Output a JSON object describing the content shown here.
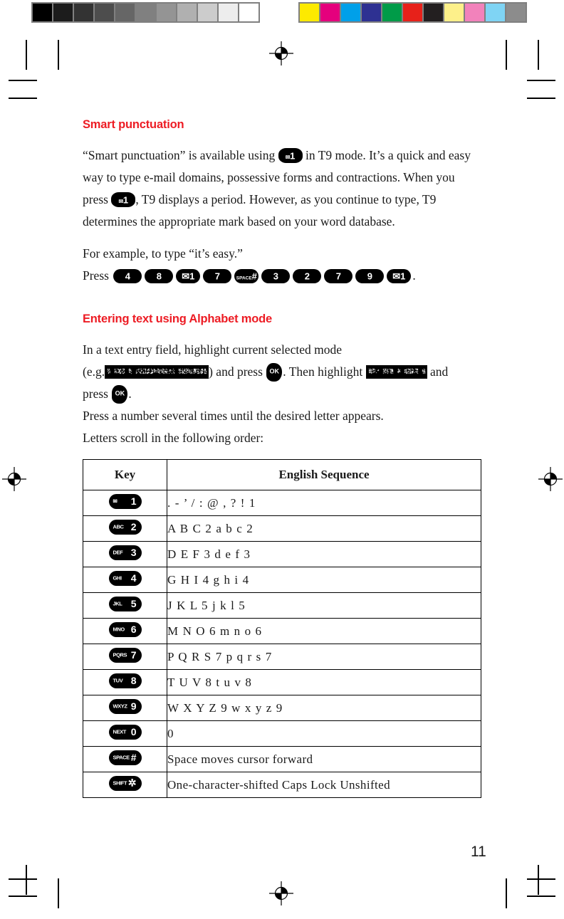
{
  "page": {
    "number": "11"
  },
  "calibration": {
    "grayscale_label": "grayscale-step-wedge",
    "grayscale": [
      "#000000",
      "#1c1c1c",
      "#333333",
      "#4d4d4d",
      "#666666",
      "#808080",
      "#949494",
      "#b0b0b0",
      "#cccccc",
      "#ededed",
      "#ffffff"
    ],
    "color_label": "color-control-bar",
    "colors": [
      "#fdea00",
      "#e5007d",
      "#00a0e9",
      "#2e3192",
      "#009b48",
      "#e7211a",
      "#231f20",
      "#fdf08a",
      "#f282bb",
      "#7fd4f4",
      "#8c8c8c"
    ]
  },
  "accent_color": "#ED1C24",
  "sections": [
    {
      "heading": "Smart punctuation",
      "paragraphs": [
        {
          "parts": [
            {
              "t": "text",
              "v": "“Smart punctuation” is available using "
            },
            {
              "t": "key",
              "v": "1",
              "sub": "✉"
            },
            {
              "t": "text",
              "v": " in T9 mode. It’s a quick and easy way to type e-mail domains, possessive forms and contractions. When you press "
            },
            {
              "t": "key",
              "v": "1",
              "sub": "✉"
            },
            {
              "t": "text",
              "v": ", T9 displays a period. However, as you continue to type, T9 determines the appropriate mark based on your word database."
            }
          ]
        }
      ],
      "example_line": "For example, to type “it’s easy.”",
      "press_label": "Press",
      "press_sequence": [
        {
          "num": "4",
          "sub": ""
        },
        {
          "num": "8",
          "sub": ""
        },
        {
          "num": "1",
          "sub": "✉"
        },
        {
          "num": "7",
          "sub": ""
        },
        {
          "num": "#",
          "sub": "SPACE"
        },
        {
          "num": "3",
          "sub": ""
        },
        {
          "num": "2",
          "sub": ""
        },
        {
          "num": "7",
          "sub": ""
        },
        {
          "num": "9",
          "sub": ""
        },
        {
          "num": "1",
          "sub": "✉"
        }
      ],
      "press_period": "."
    },
    {
      "heading": "Entering text using Alphabet mode",
      "line1": "In a text entry field, highlight current selected mode",
      "line2_a": "(e.g.",
      "lcd1": "lcd-mode-indicator-display",
      "line2_b": ") and press ",
      "ok_label": "OK",
      "line2_c": ". Then highlight ",
      "lcd2": "lcd-alphabet-option-display",
      "line2_d": " and",
      "line3_a": "press ",
      "line3_b": ".",
      "line4": "Press a number several times until the desired letter appears.",
      "line5": "Letters scroll in the following order:"
    }
  ],
  "table": {
    "headers": [
      "Key",
      "English Sequence"
    ],
    "rows": [
      {
        "key_sub": "✉",
        "key_num": "1",
        "sequence": ". - ’ / : @ , ? ! 1"
      },
      {
        "key_sub": "ABC",
        "key_num": "2",
        "sequence": "A B C 2 a b c 2"
      },
      {
        "key_sub": "DEF",
        "key_num": "3",
        "sequence": "D E F 3 d e f  3"
      },
      {
        "key_sub": "GHI",
        "key_num": "4",
        "sequence": "G H I 4 g h i 4"
      },
      {
        "key_sub": "JKL",
        "key_num": "5",
        "sequence": "J K L 5 j k l 5"
      },
      {
        "key_sub": "MNO",
        "key_num": "6",
        "sequence": "M N O 6 m n o 6"
      },
      {
        "key_sub": "PQRS",
        "key_num": "7",
        "sequence": "P Q R S 7 p q r s 7"
      },
      {
        "key_sub": "TUV",
        "key_num": "8",
        "sequence": "T U V 8 t u v 8"
      },
      {
        "key_sub": "WXYZ",
        "key_num": "9",
        "sequence": "W X Y Z 9 w x y z 9"
      },
      {
        "key_sub": "NEXT",
        "key_num": "0",
        "sequence": "0"
      },
      {
        "key_sub": "SPACE",
        "key_num": "#",
        "sequence": "Space   moves cursor forward"
      },
      {
        "key_sub": "SHIFT",
        "key_num": "✲",
        "sequence": "One-character-shifted   Caps Lock   Unshifted"
      }
    ]
  }
}
